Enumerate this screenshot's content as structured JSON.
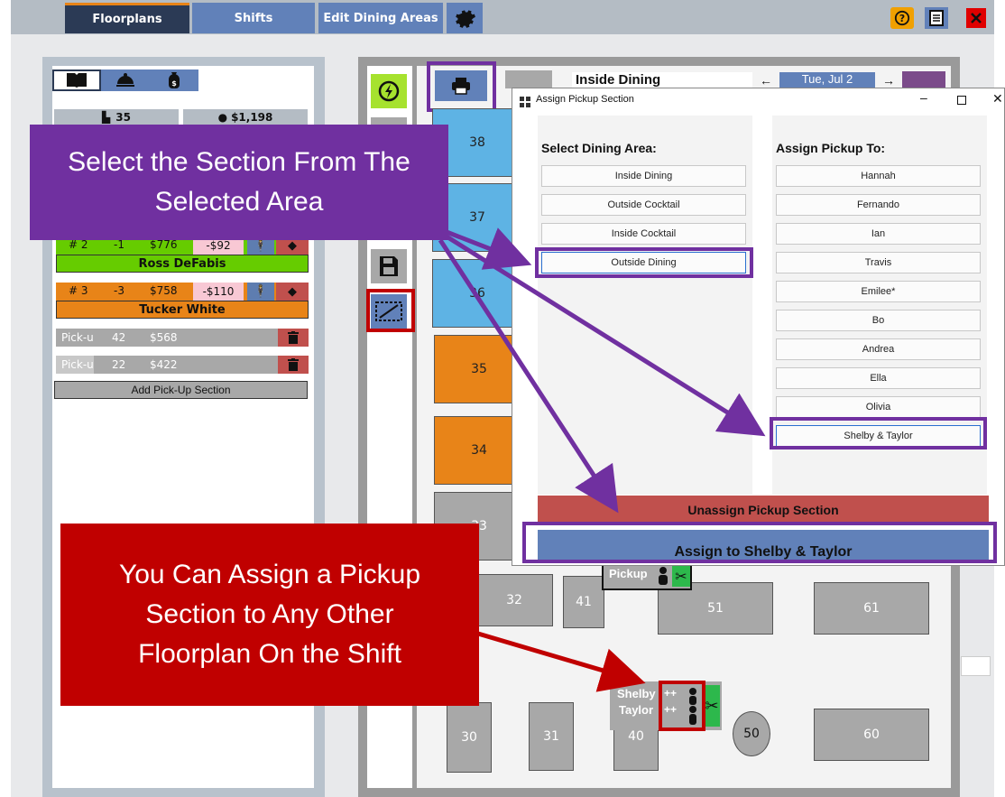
{
  "tabs": [
    "Floorplans",
    "Shifts",
    "Edit Dining Areas"
  ],
  "top_icons": [
    "help-icon",
    "notes-icon",
    "close-icon"
  ],
  "left": {
    "stats": [
      "35",
      "$1,198"
    ],
    "servers": [
      {
        "num": "# 2",
        "delta": "-1",
        "amount": "$776",
        "diff": "-$92",
        "name": "Ross DeFabis"
      },
      {
        "num": "# 3",
        "delta": "-3",
        "amount": "$758",
        "diff": "-$110",
        "name": "Tucker White"
      }
    ],
    "pickups": [
      {
        "label": "Pick-u",
        "count": "42",
        "amount": "$568"
      },
      {
        "label": "Pick-u",
        "count": "22",
        "amount": "$422"
      }
    ],
    "add_pickup": "Add Pick-Up Section"
  },
  "header": {
    "area": "Inside Dining",
    "date": "Tue, Jul 2"
  },
  "tables": {
    "t38": "38",
    "t37": "37",
    "t36": "36",
    "t35": "35",
    "t34": "34",
    "t33": "33",
    "t32": "32",
    "t41": "41",
    "t51": "51",
    "t61": "61",
    "t30": "30",
    "t31": "31",
    "t40": "40",
    "t50": "50",
    "t60": "60"
  },
  "pickup_tag": "Pickup",
  "pickup_names": [
    "Shelby",
    "Taylor"
  ],
  "pickup_plus": "++",
  "dialog": {
    "title": "Assign Pickup Section",
    "col1_title": "Select Dining Area:",
    "areas": [
      "Inside Dining",
      "Outside Cocktail",
      "Inside Cocktail",
      "Outside Dining"
    ],
    "col2_title": "Assign Pickup To:",
    "people": [
      "Hannah",
      "Fernando",
      "Ian",
      "Travis",
      "Emilee*",
      "Bo",
      "Andrea",
      "Ella",
      "Olivia",
      "Shelby & Taylor"
    ],
    "unassign": "Unassign Pickup Section",
    "assign": "Assign to Shelby & Taylor"
  },
  "callouts": {
    "purple": "Select the Section From The Selected Area",
    "red": "You Can Assign a Pickup Section to Any Other Floorplan On the Shift"
  },
  "colors": {
    "purple": "#7030a0",
    "red": "#c00000",
    "green": "#66cc00",
    "orange": "#e88418",
    "blue_table": "#5eb3e4"
  }
}
